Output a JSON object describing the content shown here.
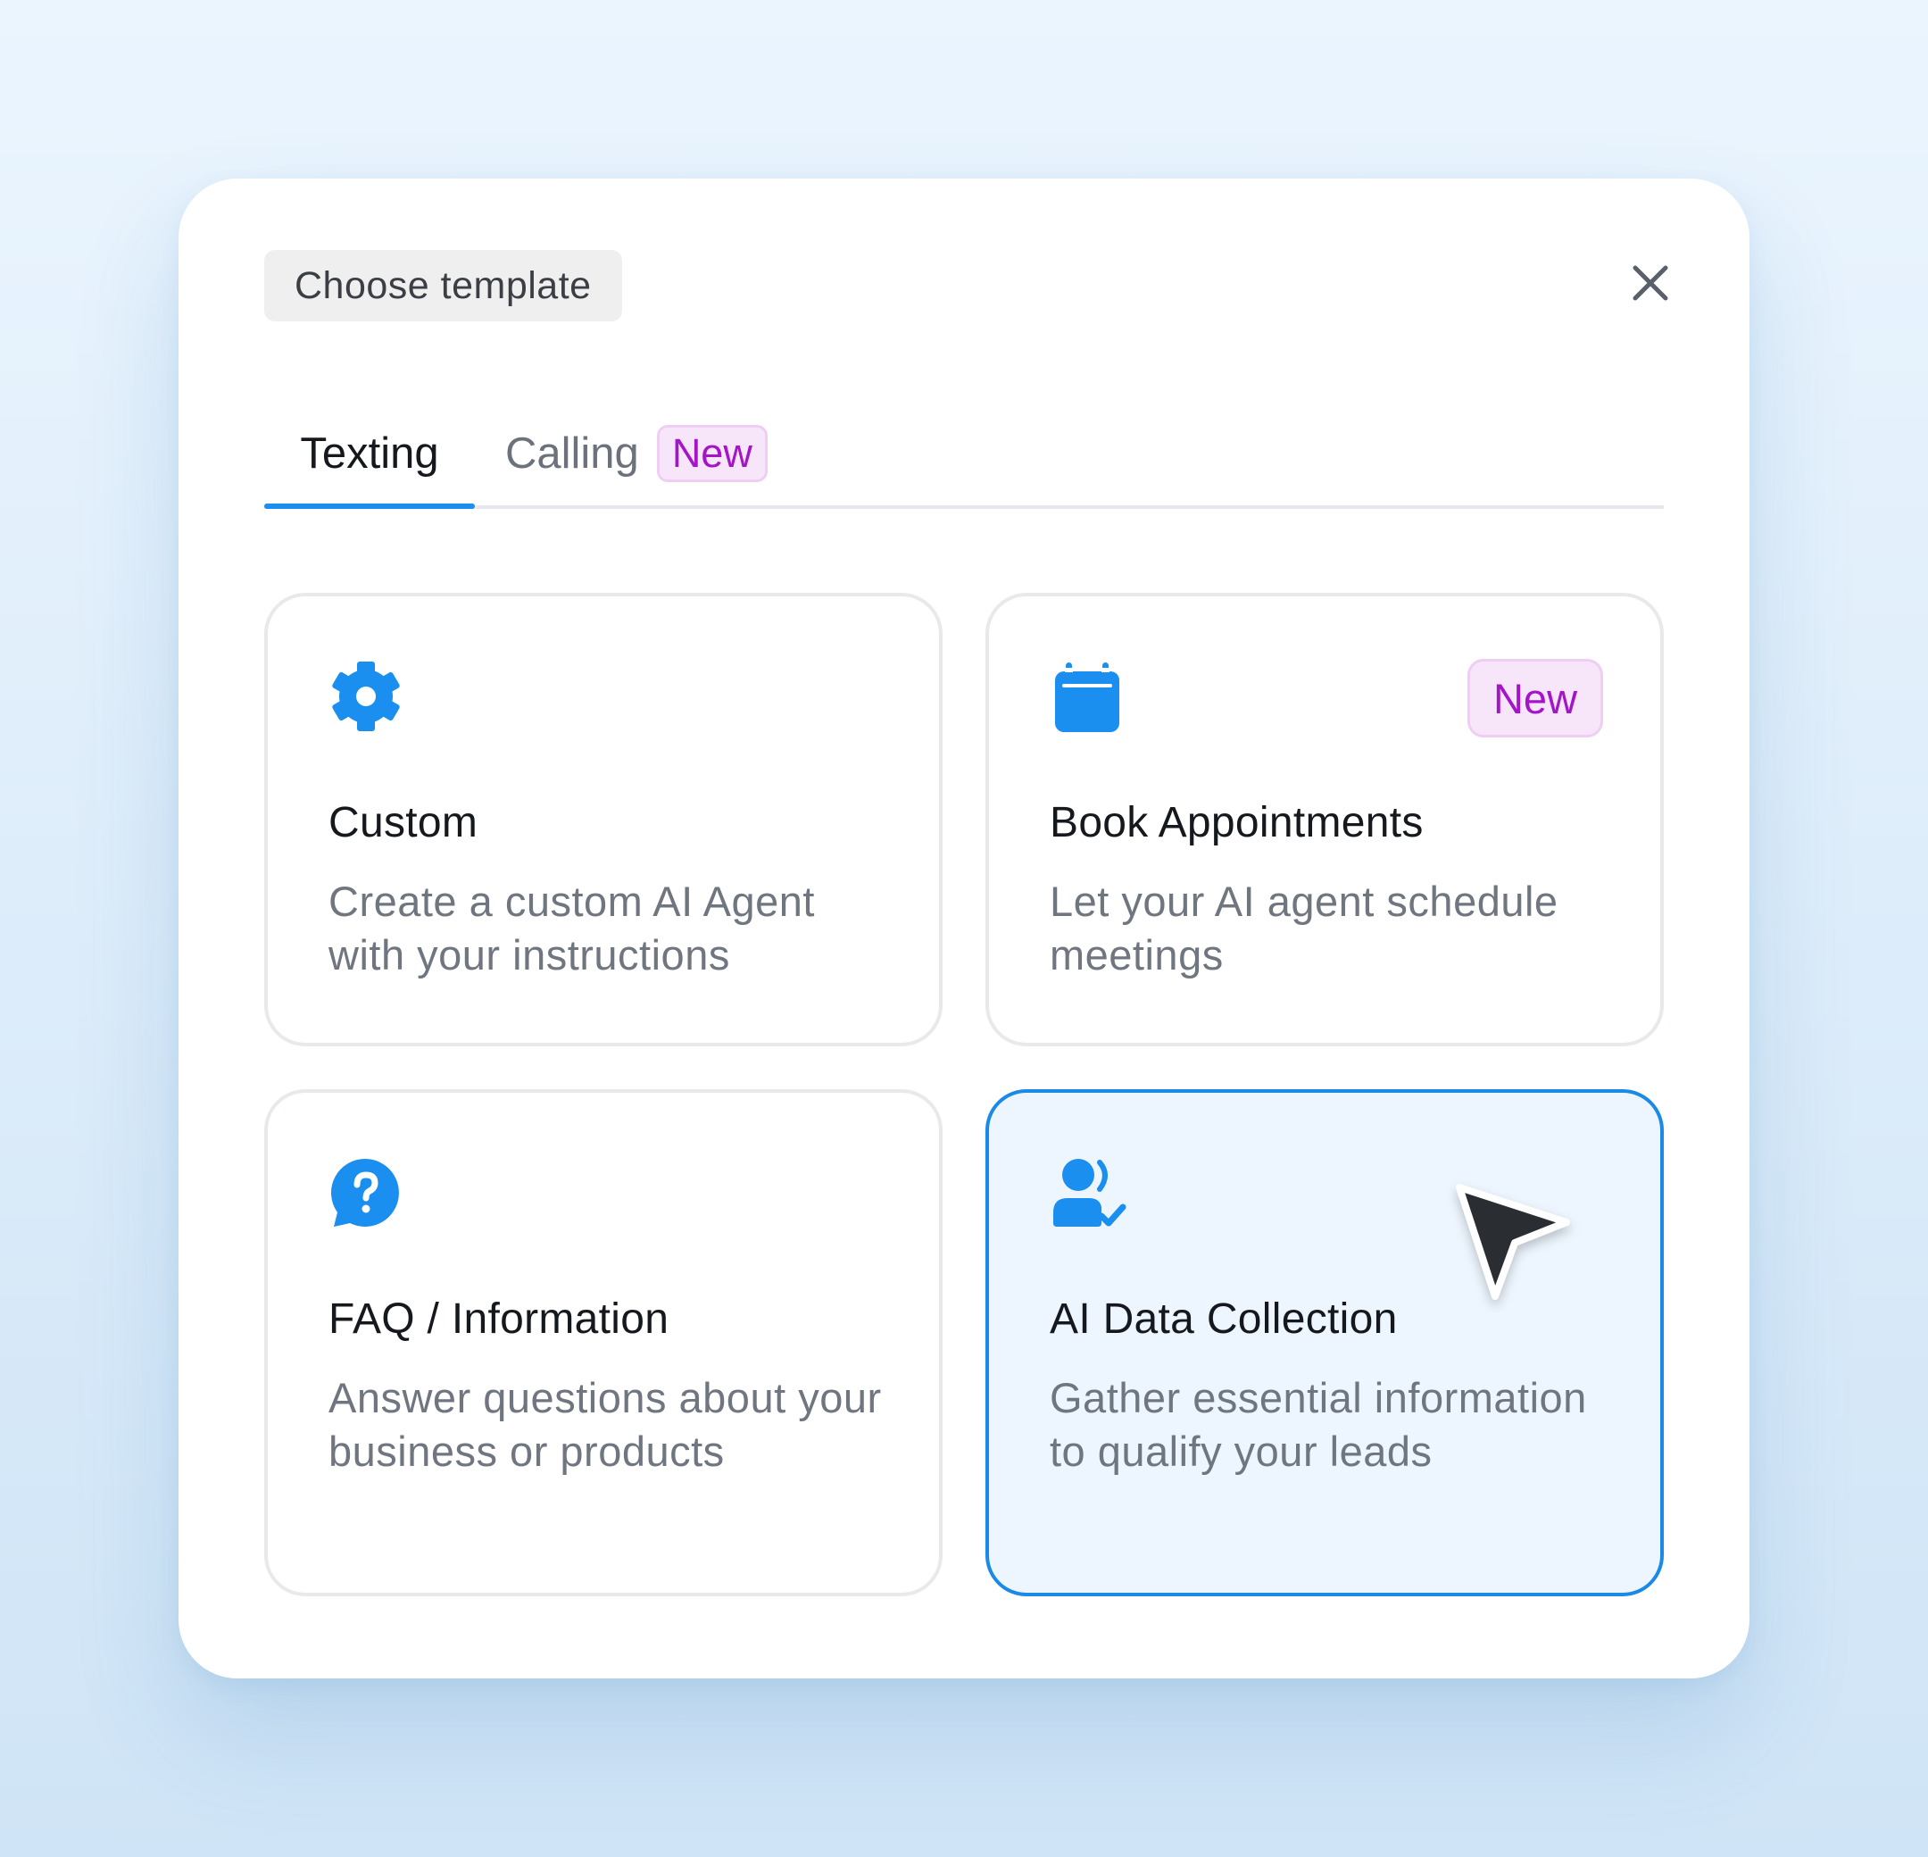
{
  "dialog": {
    "title": "Choose template",
    "close_icon": "close-icon"
  },
  "tabs": [
    {
      "label": "Texting",
      "active": true
    },
    {
      "label": "Calling",
      "badge": "New",
      "active": false
    }
  ],
  "templates": [
    {
      "icon": "gear-icon",
      "title": "Custom",
      "description": "Create a custom AI Agent with your instructions"
    },
    {
      "icon": "calendar-icon",
      "title": "Book Appointments",
      "description": "Let your AI agent schedule meetings",
      "badge": "New"
    },
    {
      "icon": "question-chat-icon",
      "title": "FAQ / Information",
      "description": "Answer questions about your business or products"
    },
    {
      "icon": "user-check-icon",
      "title": "AI Data Collection",
      "description": "Gather essential information to qualify your leads",
      "selected": true
    }
  ],
  "colors": {
    "accent": "#1b8fef",
    "badge_text": "#a414c9",
    "badge_bg": "#f7e6f9",
    "selected_bg": "#edf5fe"
  }
}
